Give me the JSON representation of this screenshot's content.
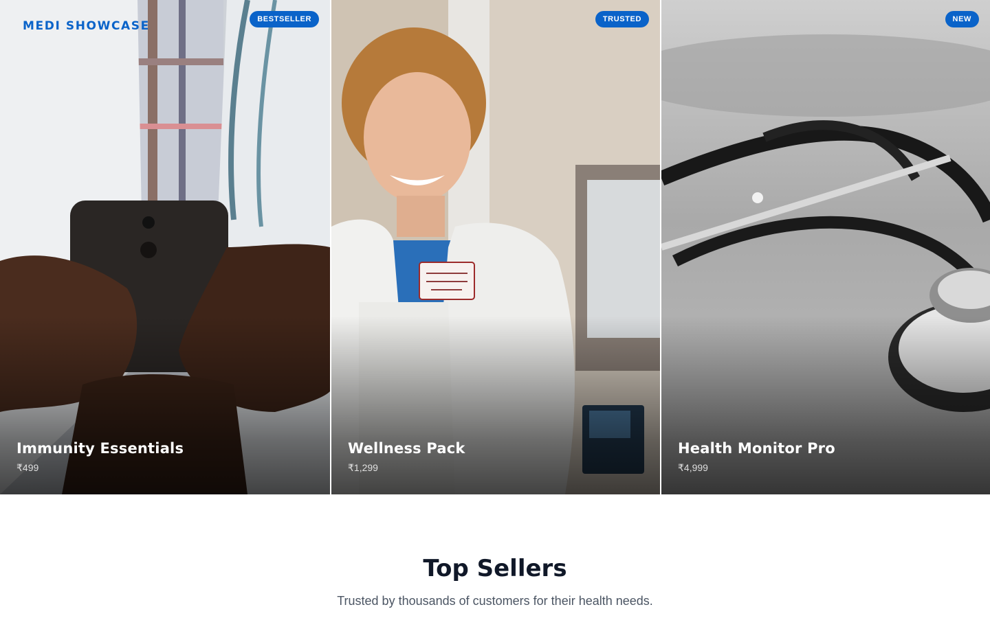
{
  "brand": "MEDI SHOWCASE",
  "cards": [
    {
      "badge": "BESTSELLER",
      "title": "Immunity Essentials",
      "price": "₹499"
    },
    {
      "badge": "TRUSTED",
      "title": "Wellness Pack",
      "price": "₹1,299"
    },
    {
      "badge": "NEW",
      "title": "Health Monitor Pro",
      "price": "₹4,999"
    }
  ],
  "section": {
    "title": "Top Sellers",
    "subtitle": "Trusted by thousands of customers for their health needs."
  }
}
